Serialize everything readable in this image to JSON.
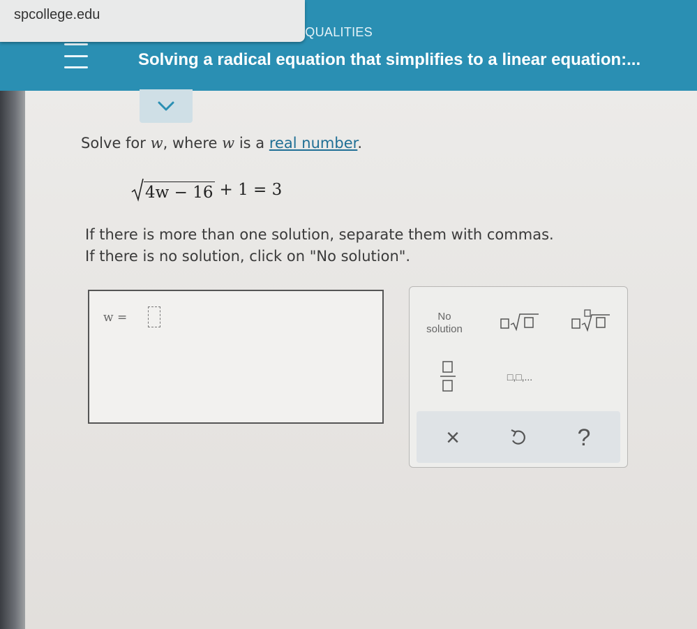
{
  "browser": {
    "url": "spcollege.edu"
  },
  "header": {
    "section": "EQUALITIES",
    "title": "Solving a radical equation that simplifies to a linear equation:..."
  },
  "problem": {
    "instruction_prefix": "Solve for",
    "variable": "w",
    "instruction_middle": ", where",
    "instruction_middle2": "is a",
    "link_text": "real number",
    "instruction_suffix": ".",
    "equation": {
      "radicand": "4w − 16",
      "rest": "+ 1 = 3"
    },
    "note_line1": "If there is more than one solution, separate them with commas.",
    "note_line2": "If there is no solution, click on \"No solution\"."
  },
  "answer": {
    "label": "w =",
    "value": ""
  },
  "keypad": {
    "no_solution_line1": "No",
    "no_solution_line2": "solution",
    "list_label": "□,□,...",
    "clear": "×",
    "help": "?"
  },
  "colors": {
    "header_bg": "#2a8fb3",
    "link": "#1f6f95"
  }
}
